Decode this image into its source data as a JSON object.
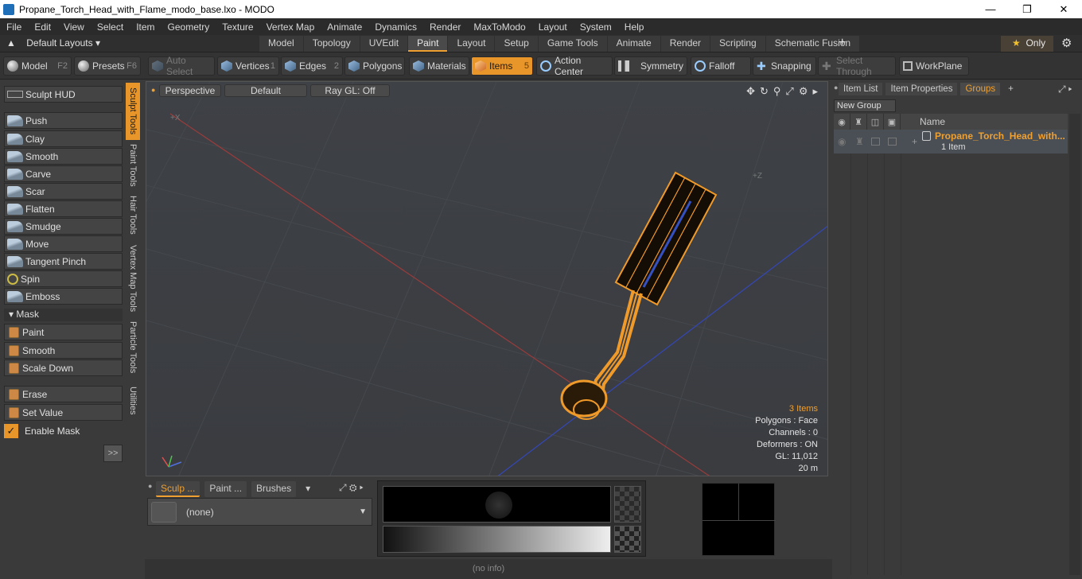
{
  "window": {
    "title": "Propane_Torch_Head_with_Flame_modo_base.lxo - MODO"
  },
  "menu": [
    "File",
    "Edit",
    "View",
    "Select",
    "Item",
    "Geometry",
    "Texture",
    "Vertex Map",
    "Animate",
    "Dynamics",
    "Render",
    "MaxToModo",
    "Layout",
    "System",
    "Help"
  ],
  "layouts": {
    "dropdown": "Default Layouts",
    "tabs": [
      "Model",
      "Topology",
      "UVEdit",
      "Paint",
      "Layout",
      "Setup",
      "Game Tools",
      "Animate",
      "Render",
      "Scripting",
      "Schematic Fusion"
    ],
    "active_tab": "Paint",
    "only_label": "Only"
  },
  "toolbar": {
    "model": "Model",
    "model_key": "F2",
    "presets": "Presets",
    "presets_key": "F6",
    "auto_select": "Auto Select",
    "vertices": "Vertices",
    "vertices_key": "1",
    "edges": "Edges",
    "edges_key": "2",
    "polygons": "Polygons",
    "materials": "Materials",
    "items": "Items",
    "items_key": "5",
    "action_center": "Action Center",
    "symmetry": "Symmetry",
    "falloff": "Falloff",
    "snapping": "Snapping",
    "select_through": "Select Through",
    "workplane": "WorkPlane"
  },
  "sculpt": {
    "hud": "Sculpt HUD",
    "tools": [
      "Push",
      "Clay",
      "Smooth",
      "Carve",
      "Scar",
      "Flatten",
      "Smudge",
      "Move",
      "Tangent Pinch",
      "Spin",
      "Emboss"
    ],
    "mask_header": "Mask",
    "mask_tools": [
      "Paint",
      "Smooth",
      "Scale Down"
    ],
    "mask_tools2": [
      "Erase",
      "Set Value"
    ],
    "enable_mask": "Enable Mask",
    "expand": ">>"
  },
  "vertical_tabs": [
    "Sculpt Tools",
    "Paint Tools",
    "Hair Tools",
    "Vertex Map Tools",
    "Particle Tools",
    "Utilities"
  ],
  "viewport": {
    "view": "Perspective",
    "shading": "Default",
    "render": "Ray GL: Off",
    "axis_x": "+X",
    "axis_z": "+Z",
    "info": {
      "items": "3 Items",
      "polygons": "Polygons : Face",
      "channels": "Channels : 0",
      "deformers": "Deformers : ON",
      "gl": "GL: 11,012",
      "scale": "20 m"
    }
  },
  "bottom": {
    "tabs": [
      "Sculp ...",
      "Paint ...",
      "Brushes"
    ],
    "preset": "(none)"
  },
  "status": "(no info)",
  "right": {
    "tabs": [
      "Item List",
      "Item Properties",
      "Groups"
    ],
    "active_tab": "Groups",
    "new_group": "New Group",
    "col_name": "Name",
    "group_name": "Propane_Torch_Head_with...",
    "group_count": "1 Item"
  },
  "colors": {
    "accent": "#e8962a",
    "mesh": "#f09a2a",
    "axis_x": "#b04040",
    "axis_z": "#3048c0"
  }
}
